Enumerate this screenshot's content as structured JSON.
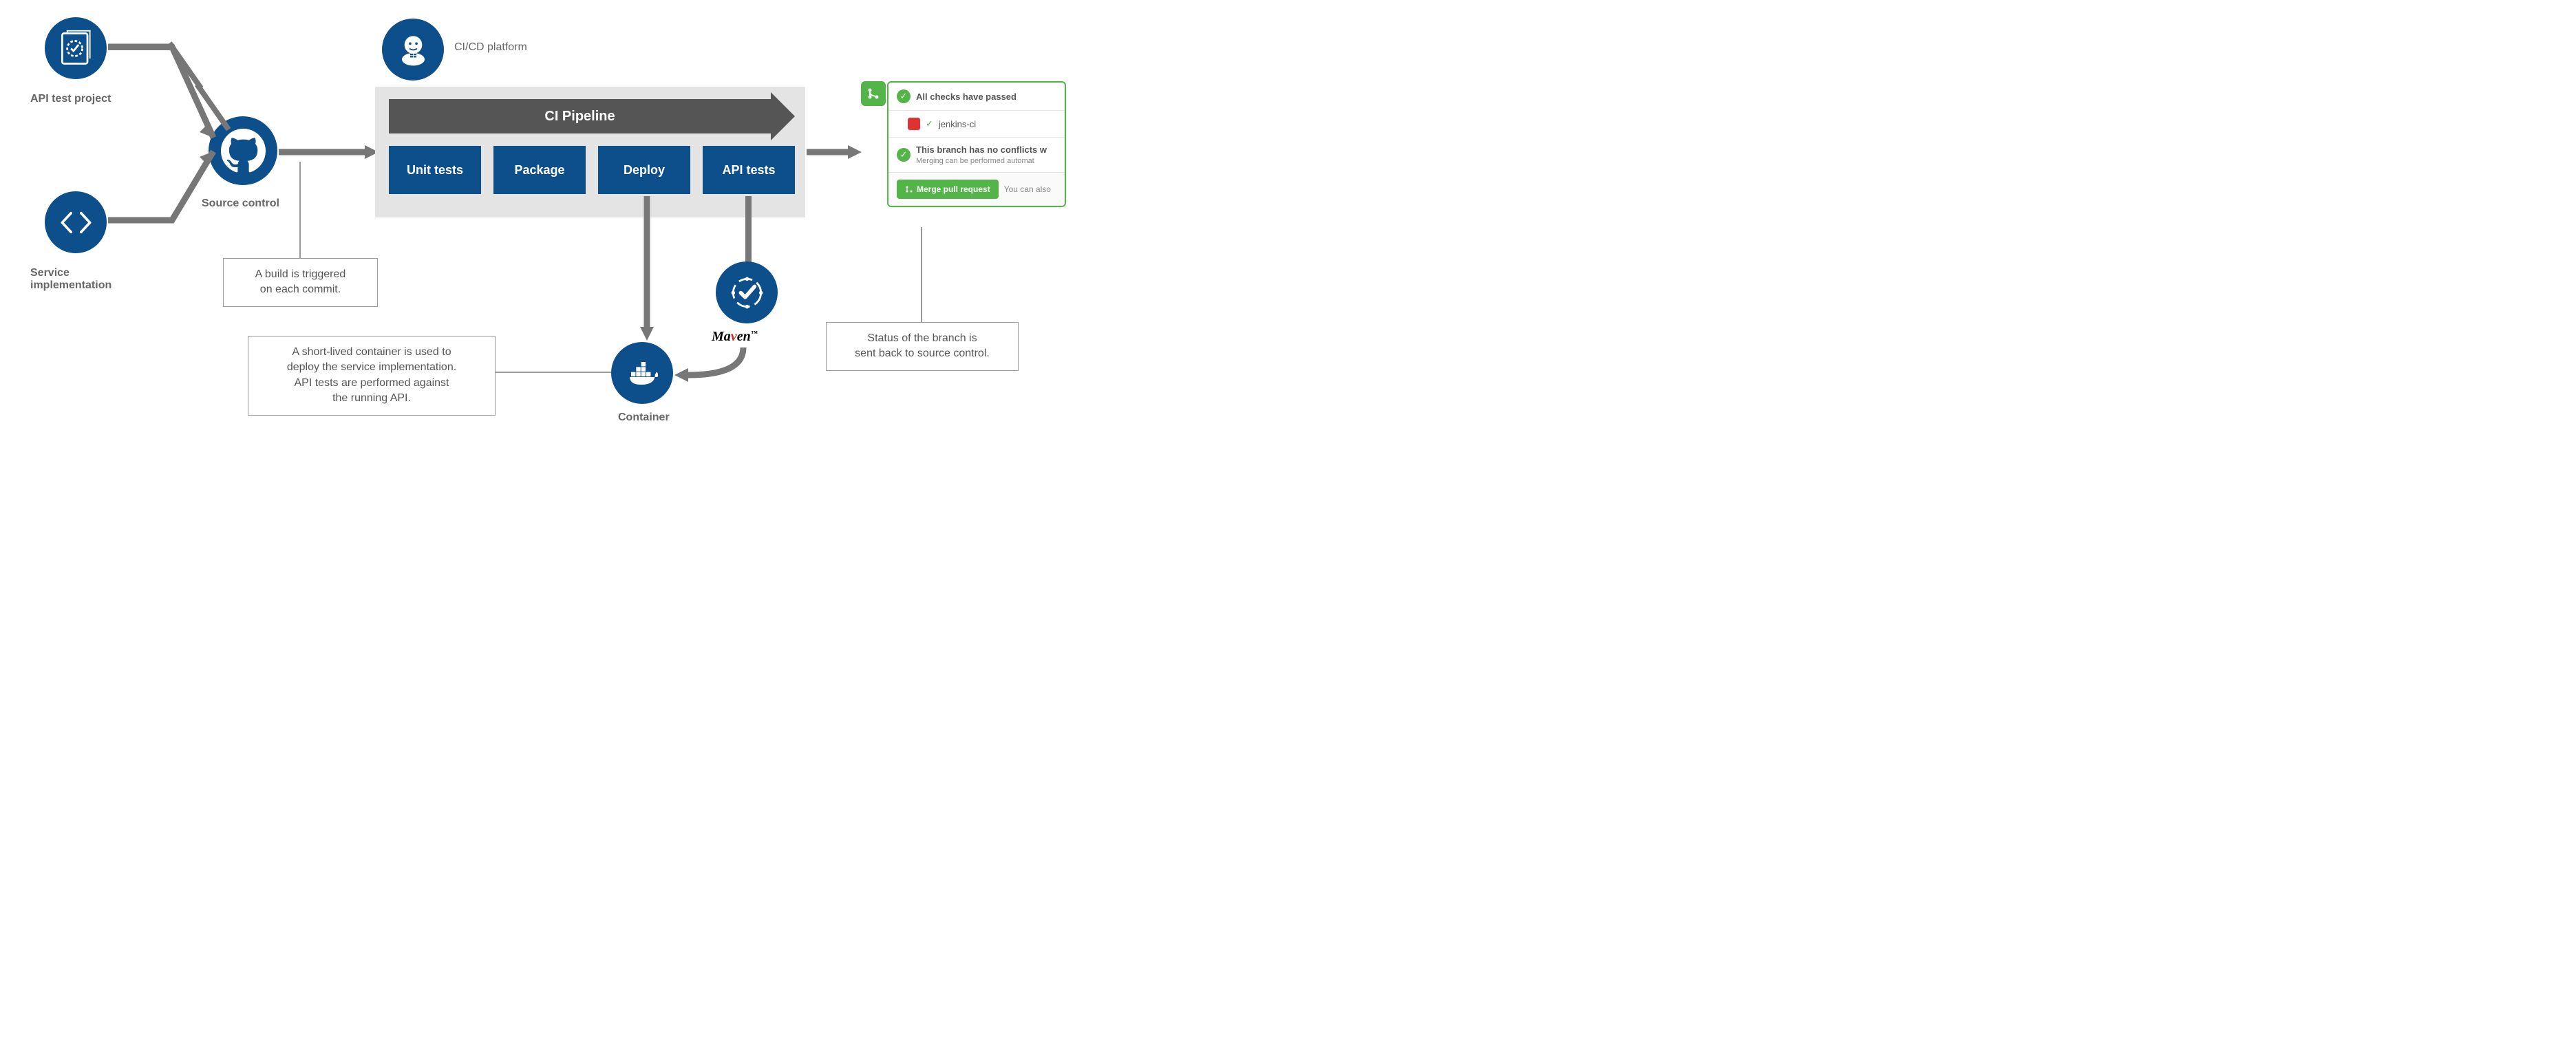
{
  "nodes": {
    "api_test_project": "API test project",
    "service_impl": "Service\nimplementation",
    "source_control": "Source control",
    "cicd_platform": "CI/CD platform",
    "container": "Container",
    "maven_part1": "Ma",
    "maven_v": "v",
    "maven_part2": "en"
  },
  "pipeline": {
    "title": "CI Pipeline",
    "stages": [
      "Unit tests",
      "Package",
      "Deploy",
      "API tests"
    ]
  },
  "callouts": {
    "build": "A build is triggered\non each commit.",
    "container": "A short-lived container is used to\ndeploy the service implementation.\nAPI tests are performed against\nthe running API.",
    "status": "Status of the branch is\nsent back to source control."
  },
  "pr": {
    "checks_passed": "All checks have passed",
    "jenkins": "jenkins-ci",
    "no_conflicts": "This branch has no conflicts w",
    "no_conflicts_sub": "Merging can be performed automat",
    "merge_btn": "Merge pull request",
    "you_can": "You can also"
  }
}
